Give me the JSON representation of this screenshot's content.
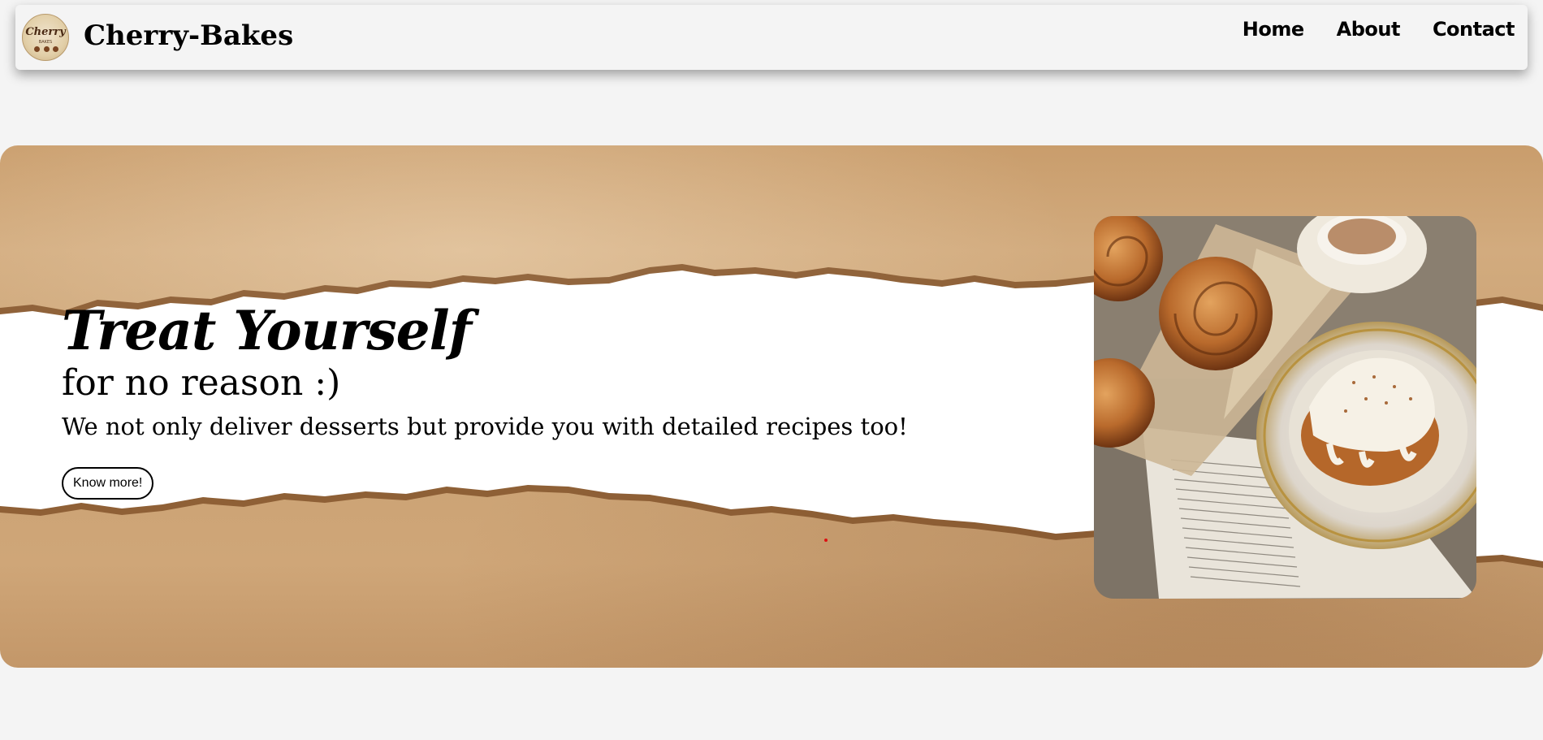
{
  "header": {
    "logo_text": "Cherry",
    "logo_sub": "BAKES",
    "brand": "Cherry-Bakes",
    "nav": [
      "Home",
      "About",
      "Contact"
    ]
  },
  "hero": {
    "title": "Treat Yourself",
    "subtitle": "for no reason :)",
    "description": "We not only deliver desserts but provide you with detailed recipes too!",
    "button_label": "Know more!",
    "image_icon": "cinnamon-roll-photo"
  },
  "colors": {
    "background": "#f4f4f4",
    "paper": "#c9a173",
    "accent_dot": "#dd1111"
  }
}
